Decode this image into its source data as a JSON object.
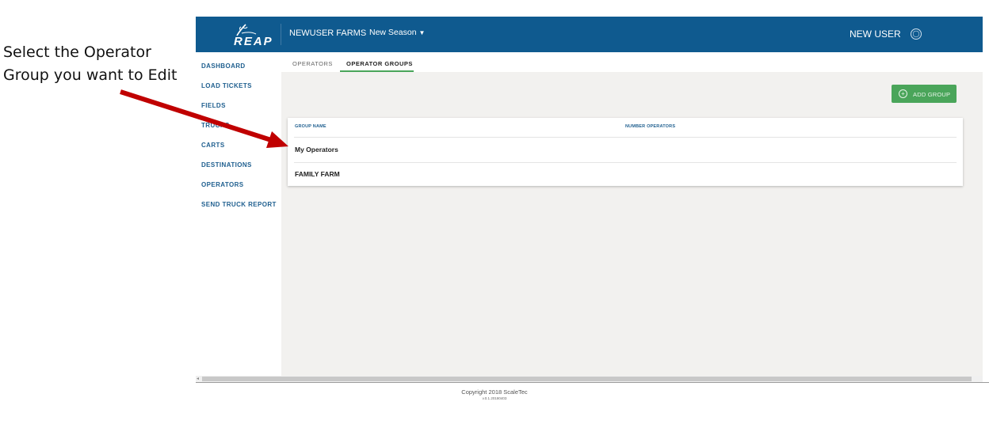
{
  "annotation": {
    "line1": "Select the Operator",
    "line2": "Group you want to Edit",
    "arrow_color": "#c00000"
  },
  "header": {
    "logo_text": "REAP",
    "farm_name": "NEWUSER FARMS",
    "season": "New Season",
    "user": "NEW USER",
    "bar_color": "#0f5a8f"
  },
  "sidebar": {
    "items": [
      {
        "label": "DASHBOARD"
      },
      {
        "label": "LOAD TICKETS"
      },
      {
        "label": "FIELDS"
      },
      {
        "label": "TRUCKS"
      },
      {
        "label": "CARTS"
      },
      {
        "label": "DESTINATIONS"
      },
      {
        "label": "OPERATORS"
      },
      {
        "label": "SEND TRUCK REPORT"
      }
    ]
  },
  "tabs": [
    {
      "label": "OPERATORS",
      "active": false
    },
    {
      "label": "OPERATOR GROUPS",
      "active": true
    }
  ],
  "toolbar": {
    "add_label": "ADD GROUP",
    "accent": "#4aa55a"
  },
  "table": {
    "columns": [
      "GROUP NAME",
      "NUMBER OPERATORS"
    ],
    "rows": [
      {
        "name": "My Operators",
        "count": ""
      },
      {
        "name": "FAMILY FARM",
        "count": ""
      }
    ]
  },
  "footer": {
    "copyright": "Copyright 2018 ScaleTec",
    "version": "v.0.1.20180403"
  }
}
